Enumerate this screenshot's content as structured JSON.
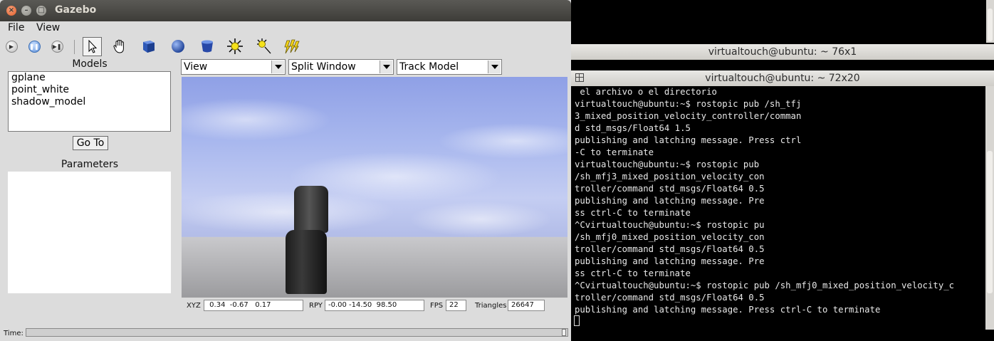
{
  "gazebo": {
    "title": "Gazebo",
    "window_buttons": {
      "close": "×",
      "minimize": "–",
      "maximize": "□"
    },
    "menu": [
      "File",
      "View"
    ],
    "toolbar": [
      "play-icon",
      "pause-icon",
      "step-icon",
      "select-arrow-icon",
      "pan-hand-icon",
      "box-icon",
      "sphere-icon",
      "cylinder-icon",
      "point-light-icon",
      "spot-light-icon",
      "directional-light-icon"
    ],
    "models_label": "Models",
    "models": [
      "gplane",
      "point_white",
      "shadow_model"
    ],
    "goto_label": "Go To",
    "parameters_label": "Parameters",
    "dropdowns": {
      "view": "View",
      "split": "Split Window",
      "track": "Track Model"
    },
    "status": {
      "xyz_label": "XYZ",
      "xyz": " 0.34  -0.67   0.17",
      "rpy_label": "RPY",
      "rpy": "-0.00 -14.50  98.50",
      "fps_label": "FPS",
      "fps": "22",
      "triangles_label": "Triangles",
      "triangles": "26647"
    },
    "time_label": "Time:"
  },
  "terminal1": {
    "title": "virtualtouch@ubuntu: ~ 76x1"
  },
  "terminal2": {
    "title": "virtualtouch@ubuntu: ~ 72x20",
    "lines": [
      " el archivo o el directorio",
      "virtualtouch@ubuntu:~$ rostopic pub /sh_tfj",
      "3_mixed_position_velocity_controller/comman",
      "d std_msgs/Float64 1.5",
      "publishing and latching message. Press ctrl",
      "-C to terminate",
      "virtualtouch@ubuntu:~$ rostopic pub",
      "/sh_mfj3_mixed_position_velocity_con",
      "troller/command std_msgs/Float64 0.5",
      "publishing and latching message. Pre",
      "ss ctrl-C to terminate",
      "^Cvirtualtouch@ubuntu:~$ rostopic pu",
      "/sh_mfj0_mixed_position_velocity_con",
      "troller/command std_msgs/Float64 0.5",
      "publishing and latching message. Pre",
      "ss ctrl-C to terminate",
      "^Cvirtualtouch@ubuntu:~$ rostopic pub /sh_mfj0_mixed_position_velocity_c",
      "troller/command std_msgs/Float64 0.5",
      "publishing and latching message. Press ctrl-C to terminate"
    ]
  }
}
